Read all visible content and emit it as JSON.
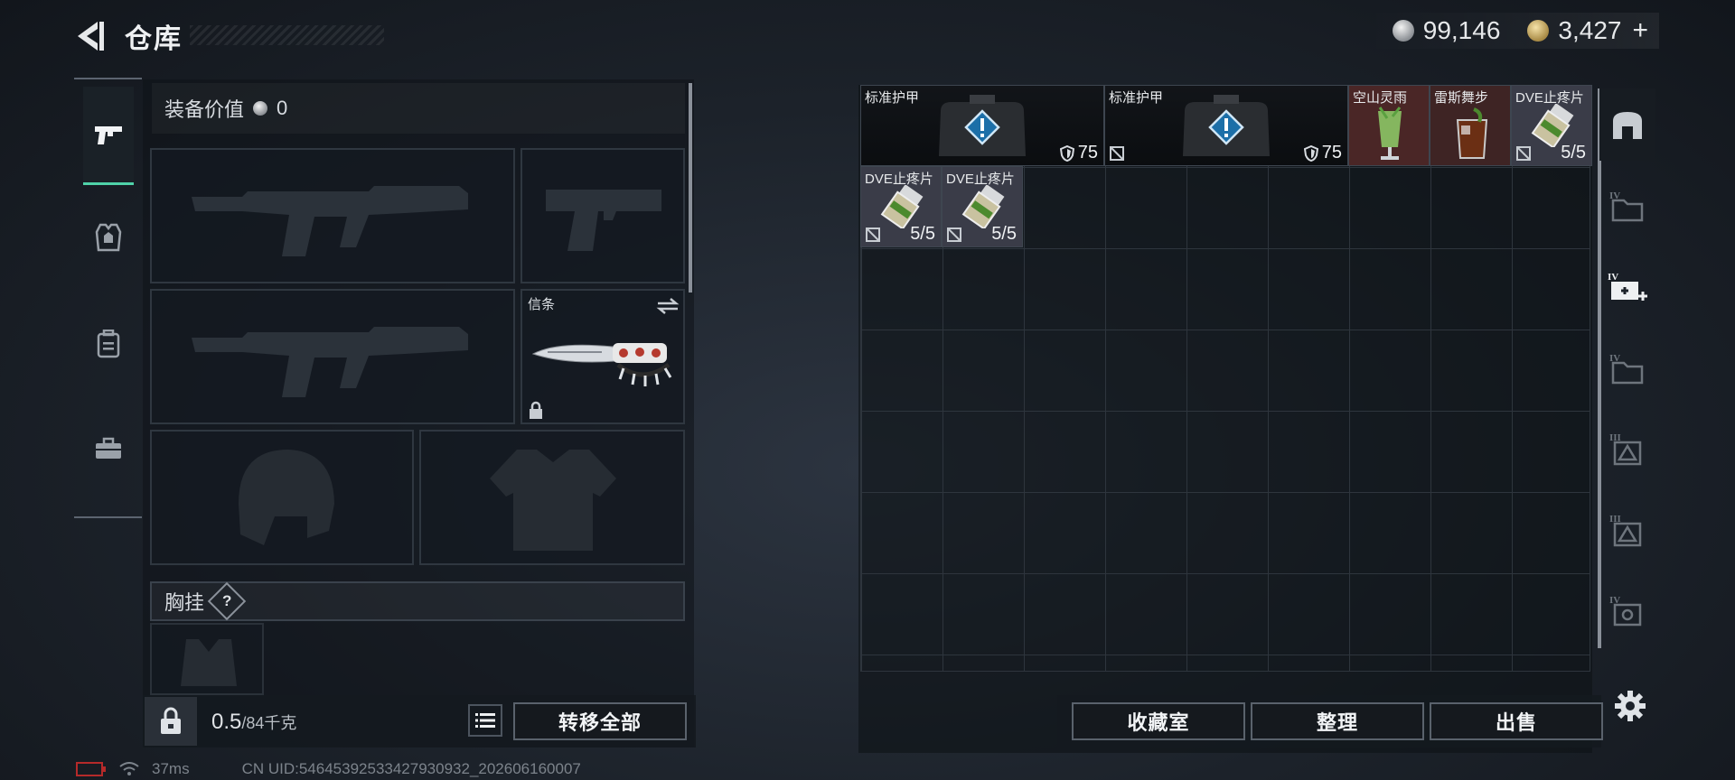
{
  "header": {
    "title": "仓库",
    "silver_amount": "99,146",
    "gold_amount": "3,427",
    "add_label": "+"
  },
  "left_tabs": [
    {
      "name": "weapon",
      "icon": "pistol-icon",
      "active": true
    },
    {
      "name": "armor",
      "icon": "armor-vest-icon",
      "active": false
    },
    {
      "name": "backpack",
      "icon": "backpack-icon",
      "active": false
    },
    {
      "name": "kit",
      "icon": "briefcase-icon",
      "active": false
    }
  ],
  "loadout": {
    "equipment_value_label": "装备价值",
    "equipment_value": "0",
    "token_slot_label": "信条",
    "chest_rig_label": "胸挂",
    "chest_rig_help": "?"
  },
  "bottom_left": {
    "weight_current": "0.5",
    "weight_max": "/84千克",
    "transfer_all_label": "转移全部"
  },
  "stash_items": [
    {
      "name": "标准护甲",
      "value": "75",
      "type": "armor"
    },
    {
      "name": "标准护甲",
      "value": "75",
      "type": "armor"
    },
    {
      "name": "空山灵雨",
      "value": "",
      "type": "drink"
    },
    {
      "name": "雷斯舞步",
      "value": "",
      "type": "drink"
    },
    {
      "name": "DVE止疼片",
      "value": "5/5",
      "type": "pill"
    },
    {
      "name": "DVE止疼片",
      "value": "5/5",
      "type": "pill"
    },
    {
      "name": "DVE止疼片",
      "value": "5/5",
      "type": "pill"
    }
  ],
  "right_tabs": [
    {
      "icon": "stash-arch-icon"
    },
    {
      "icon": "folder-tier-iv-icon"
    },
    {
      "icon": "add-stash-iv-icon"
    },
    {
      "icon": "folder-tier-iv-icon"
    },
    {
      "icon": "ticket-tier-iii-icon"
    },
    {
      "icon": "ticket-tier-iii-icon"
    },
    {
      "icon": "ticket-tier-iv-icon"
    }
  ],
  "bottom_right": {
    "collection_label": "收藏室",
    "sort_label": "整理",
    "sell_label": "出售"
  },
  "status": {
    "ping": "37ms",
    "uid": "CN UID:54645392533427930932_202606160007"
  },
  "colors": {
    "accent_green": "#4fd2a8",
    "drink_bg": "#4a2626",
    "pill_bg": "#3a3c48"
  }
}
